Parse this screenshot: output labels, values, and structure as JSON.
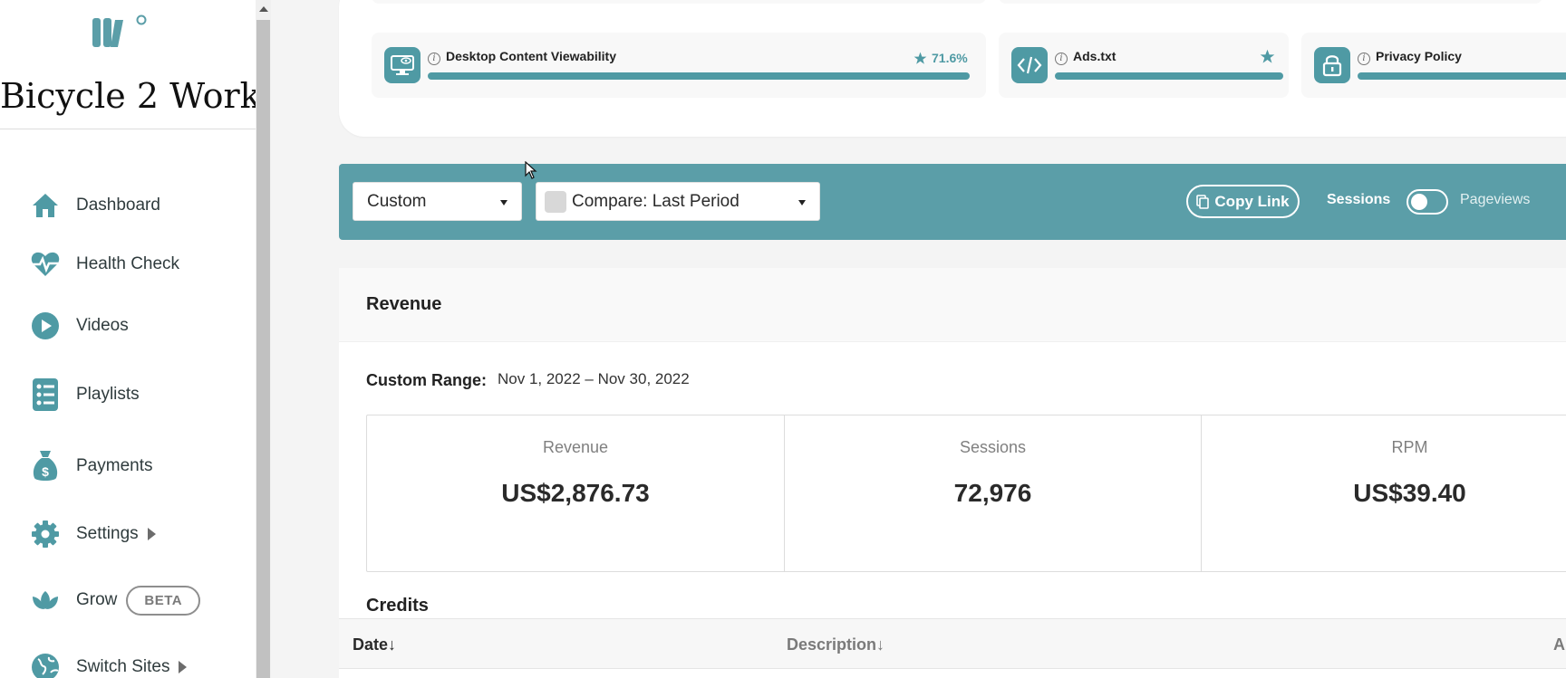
{
  "sidebar": {
    "site_name": "Bicycle 2 Work",
    "items": [
      {
        "label": "Dashboard",
        "icon": "home-icon"
      },
      {
        "label": "Health Check",
        "icon": "heartbeat-icon"
      },
      {
        "label": "Videos",
        "icon": "play-circle-icon"
      },
      {
        "label": "Playlists",
        "icon": "list-icon"
      },
      {
        "label": "Payments",
        "icon": "money-bag-icon"
      },
      {
        "label": "Settings",
        "icon": "gear-icon"
      },
      {
        "label": "Grow",
        "icon": "leaves-icon",
        "badge": "BETA"
      },
      {
        "label": "Switch Sites",
        "icon": "globe-icon"
      }
    ]
  },
  "health_check": {
    "cards": [
      {
        "label": "Desktop Content Viewability",
        "score": "71.6%",
        "icon": "monitor-eye-icon"
      },
      {
        "label": "Ads.txt",
        "icon": "code-icon"
      },
      {
        "label": "Privacy Policy",
        "icon": "lock-icon"
      }
    ]
  },
  "filters": {
    "date_select": "Custom",
    "compare_select": "Compare: Last Period",
    "copy_link": "Copy Link",
    "toggle_left": "Sessions",
    "toggle_right": "Pageviews"
  },
  "revenue": {
    "title": "Revenue",
    "range_label": "Custom Range:",
    "range_value": "Nov 1, 2022 – Nov 30, 2022",
    "stats": [
      {
        "label": "Revenue",
        "value": "US$2,876.73"
      },
      {
        "label": "Sessions",
        "value": "72,976"
      },
      {
        "label": "RPM",
        "value": "US$39.40"
      }
    ],
    "credits_title": "Credits",
    "credits_columns": [
      "Date",
      "Description",
      "A"
    ]
  },
  "colors": {
    "accent": "#5b9ea8",
    "icon_teal": "#4f9aa4"
  }
}
